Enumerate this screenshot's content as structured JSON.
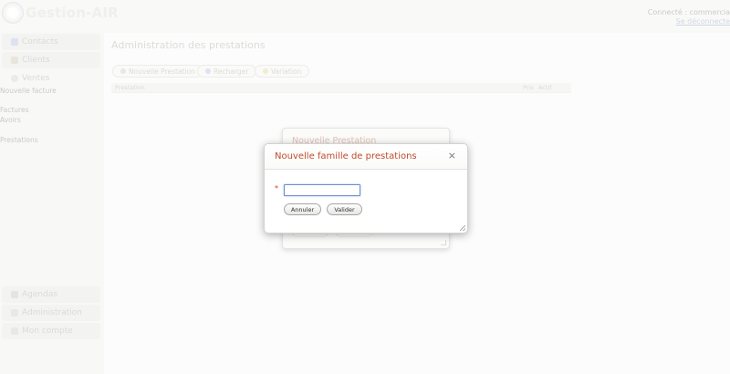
{
  "app": {
    "name": "Gestion-AIR"
  },
  "header": {
    "connected_text": "Connecté : commercia",
    "logout_label": "Se déconnecte"
  },
  "sidebar": {
    "top_items": [
      {
        "label": "Contacts",
        "icon": "contacts-icon"
      },
      {
        "label": "Clients",
        "icon": "clients-icon"
      },
      {
        "label": "Ventes",
        "icon": "ventes-icon"
      }
    ],
    "ventes_links": [
      "Nouvelle facture",
      "Factures",
      "Avoirs",
      "Prestations"
    ],
    "bottom_items": [
      {
        "label": "Agendas",
        "icon": "calendar-icon"
      },
      {
        "label": "Administration",
        "icon": "admin-icon"
      },
      {
        "label": "Mon compte",
        "icon": "account-icon"
      }
    ]
  },
  "main": {
    "title": "Administration des prestations",
    "toolbar": {
      "new_label": "Nouvelle Prestation",
      "reload_label": "Recharger",
      "variation_label": "Variation"
    },
    "grid": {
      "columns": [
        "Prestation",
        "Prix",
        "Actif"
      ]
    }
  },
  "bg_dialog": {
    "title": "Nouvelle Prestation"
  },
  "dialog": {
    "title": "Nouvelle famille de prestations",
    "close_glyph": "×",
    "required_marker": "*",
    "name_input": {
      "value": "",
      "placeholder": ""
    },
    "cancel_label": "Annuler",
    "submit_label": "Valider"
  },
  "colors": {
    "dialog_title": "#c14b2c",
    "required": "#d0362a",
    "input_focus": "#6e8fcd"
  }
}
